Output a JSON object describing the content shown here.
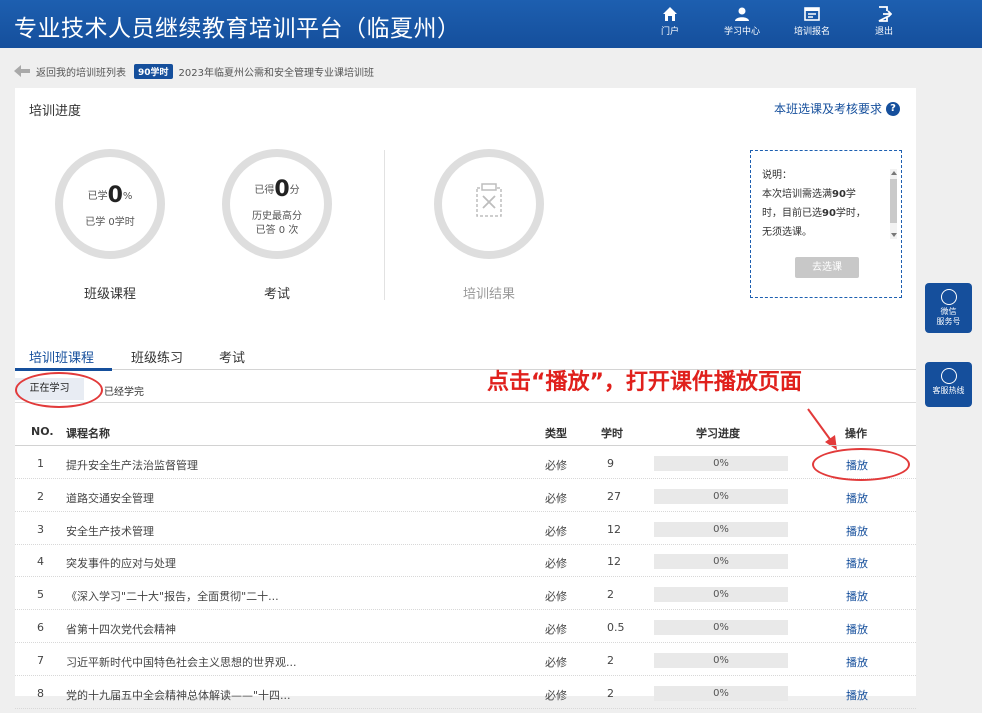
{
  "header": {
    "title": "专业技术人员继续教育培训平台（临夏州）",
    "nav": [
      {
        "label": "门户",
        "icon": "home-icon"
      },
      {
        "label": "学习中心",
        "icon": "user-icon"
      },
      {
        "label": "培训报名",
        "icon": "register-icon"
      },
      {
        "label": "退出",
        "icon": "logout-icon"
      }
    ]
  },
  "breadcrumb": {
    "back_label": "返回我的培训班列表",
    "hours_badge": "90学时",
    "class_name": "2023年临夏州公需和安全管理专业课培训班"
  },
  "progress": {
    "title": "培训进度",
    "requirements_link": "本班选课及考核要求",
    "help": "?",
    "course_ring": {
      "prefix": "已学",
      "value": "0",
      "unit": "%",
      "sub": "已学 0学时",
      "caption": "班级课程"
    },
    "exam_ring": {
      "prefix": "已得",
      "value": "0",
      "unit": "分",
      "sub1": "历史最高分",
      "sub2": "已答 0 次",
      "caption": "考试"
    },
    "result_ring": {
      "caption": "培训结果",
      "icon": "certificate-icon"
    },
    "notice": {
      "line1": "说明：",
      "line2a": "本次培训需选满",
      "line2b": "90",
      "line2c": "学",
      "line3a": "时，目前已选",
      "line3b": "90",
      "line3c": "学时，",
      "line4": "无须选课。",
      "button": "去选课"
    }
  },
  "tabs": [
    "培训班课程",
    "班级练习",
    "考试"
  ],
  "subtabs": [
    "正在学习",
    "已经学完"
  ],
  "callout": "点击“播放”，打开课件播放页面",
  "table": {
    "headers": [
      "NO.",
      "课程名称",
      "类型",
      "学时",
      "学习进度",
      "操作"
    ],
    "rows": [
      {
        "no": "1",
        "name": "提升安全生产法治监督管理",
        "type": "必修",
        "hours": "9",
        "progress": "0%",
        "action": "播放"
      },
      {
        "no": "2",
        "name": "道路交通安全管理",
        "type": "必修",
        "hours": "27",
        "progress": "0%",
        "action": "播放"
      },
      {
        "no": "3",
        "name": "安全生产技术管理",
        "type": "必修",
        "hours": "12",
        "progress": "0%",
        "action": "播放"
      },
      {
        "no": "4",
        "name": "突发事件的应对与处理",
        "type": "必修",
        "hours": "12",
        "progress": "0%",
        "action": "播放"
      },
      {
        "no": "5",
        "name": "《深入学习\"二十大\"报告，全面贯彻\"二十...",
        "type": "必修",
        "hours": "2",
        "progress": "0%",
        "action": "播放"
      },
      {
        "no": "6",
        "name": "省第十四次党代会精神",
        "type": "必修",
        "hours": "0.5",
        "progress": "0%",
        "action": "播放"
      },
      {
        "no": "7",
        "name": "习近平新时代中国特色社会主义思想的世界观...",
        "type": "必修",
        "hours": "2",
        "progress": "0%",
        "action": "播放"
      },
      {
        "no": "8",
        "name": "党的十九届五中全会精神总体解读——\"十四...",
        "type": "必修",
        "hours": "2",
        "progress": "0%",
        "action": "播放"
      }
    ]
  },
  "side": {
    "wechat": {
      "line1": "微信",
      "line2": "服务号"
    },
    "hotline": {
      "line1": "客服热线"
    }
  },
  "colors": {
    "brand": "#154f9c",
    "annotation": "#e0201c"
  }
}
